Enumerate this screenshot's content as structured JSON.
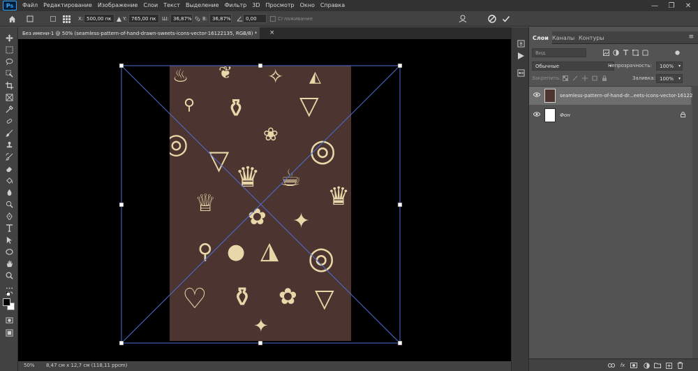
{
  "menubar": {
    "logo": "Ps",
    "items": [
      "Файл",
      "Редактирование",
      "Изображение",
      "Слои",
      "Текст",
      "Выделение",
      "Фильтр",
      "3D",
      "Просмотр",
      "Окно",
      "Справка"
    ],
    "controls": {
      "minimize": "—",
      "maximize": "❐",
      "close": "✕"
    }
  },
  "optionsbar": {
    "x_label": "X:",
    "x_value": "500,00 пк",
    "y_label": "Y:",
    "y_value": "765,00 пк",
    "w_label": "Ш:",
    "w_value": "36,87%",
    "h_label": "В:",
    "h_value": "36,87%",
    "angle_value": "0,00",
    "smoothing_label": "Сглаживание",
    "cancel_icon": "cancel-icon",
    "commit_icon": "check-icon"
  },
  "document": {
    "tab_title": "Без имени-1 @ 50% (seamless-pattern-of-hand-drawn-sweets-icons-vector-16122135, RGB/8) *",
    "close": "×",
    "artwork_color": "#4c3530",
    "glyph_color": "#e8d7a8"
  },
  "statusbar": {
    "zoom": "50%",
    "doc_info": "8,47 см x 12,7 см (118,11 ppcm)",
    "arrow": "›"
  },
  "layers_panel": {
    "tabs": [
      "Слои",
      "Каналы",
      "Контуры"
    ],
    "active_tab": 0,
    "filter_placeholder": "Вид",
    "blend_mode": "Обычные",
    "opacity_label": "Непрозрачность:",
    "opacity_value": "100%",
    "lock_label": "Закрепить:",
    "fill_label": "Заливка:",
    "fill_value": "100%",
    "layers": [
      {
        "name": "seamless-pattern-of-hand-dr...eets-icons-vector-16122135",
        "selected": true,
        "locked": false
      },
      {
        "name": "Фон",
        "selected": false,
        "locked": true
      }
    ],
    "bottom_icons": [
      "link-icon",
      "fx-icon",
      "mask-icon",
      "adjustment-icon",
      "folder-icon",
      "new-layer-icon",
      "trash-icon"
    ]
  }
}
